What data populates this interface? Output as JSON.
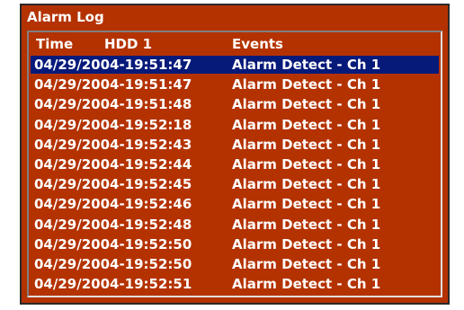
{
  "window": {
    "title": "Alarm Log"
  },
  "header": {
    "time": "Time",
    "hdd": "HDD 1",
    "events": "Events"
  },
  "rows": [
    {
      "time": "04/29/2004-19:51:47",
      "event": "Alarm Detect - Ch 1",
      "selected": true
    },
    {
      "time": "04/29/2004-19:51:47",
      "event": "Alarm Detect - Ch 1"
    },
    {
      "time": "04/29/2004-19:51:48",
      "event": "Alarm Detect - Ch 1"
    },
    {
      "time": "04/29/2004-19:52:18",
      "event": "Alarm Detect - Ch 1"
    },
    {
      "time": "04/29/2004-19:52:43",
      "event": "Alarm Detect - Ch 1"
    },
    {
      "time": "04/29/2004-19:52:44",
      "event": "Alarm Detect - Ch 1"
    },
    {
      "time": "04/29/2004-19:52:45",
      "event": "Alarm Detect - Ch 1"
    },
    {
      "time": "04/29/2004-19:52:46",
      "event": "Alarm Detect - Ch 1"
    },
    {
      "time": "04/29/2004-19:52:48",
      "event": "Alarm Detect - Ch 1"
    },
    {
      "time": "04/29/2004-19:52:50",
      "event": "Alarm Detect - Ch 1"
    },
    {
      "time": "04/29/2004-19:52:50",
      "event": "Alarm Detect - Ch 1"
    },
    {
      "time": "04/29/2004-19:52:51",
      "event": "Alarm Detect - Ch 1"
    }
  ]
}
